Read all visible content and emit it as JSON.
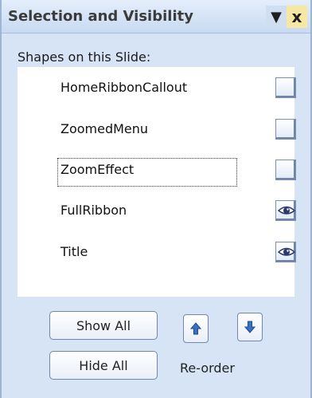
{
  "pane": {
    "title": "Selection and Visibility",
    "dropdown_icon": "chevron-down-icon",
    "close_label": "x"
  },
  "shapes_label": "Shapes on this Slide:",
  "shapes": [
    {
      "name": "HomeRibbonCallout",
      "visible": false
    },
    {
      "name": "ZoomedMenu",
      "visible": false
    },
    {
      "name": "ZoomEffect",
      "visible": false,
      "focused": true
    },
    {
      "name": "FullRibbon",
      "visible": true
    },
    {
      "name": "Title",
      "visible": true
    }
  ],
  "buttons": {
    "show_all": "Show All",
    "hide_all": "Hide All"
  },
  "reorder": {
    "label": "Re-order",
    "up_icon": "arrow-up-icon",
    "down_icon": "arrow-down-icon"
  },
  "colors": {
    "pane_bg": "#d6e4f6",
    "close_hover": "#f7e7a4",
    "arrow_blue": "#3b6fc4"
  }
}
